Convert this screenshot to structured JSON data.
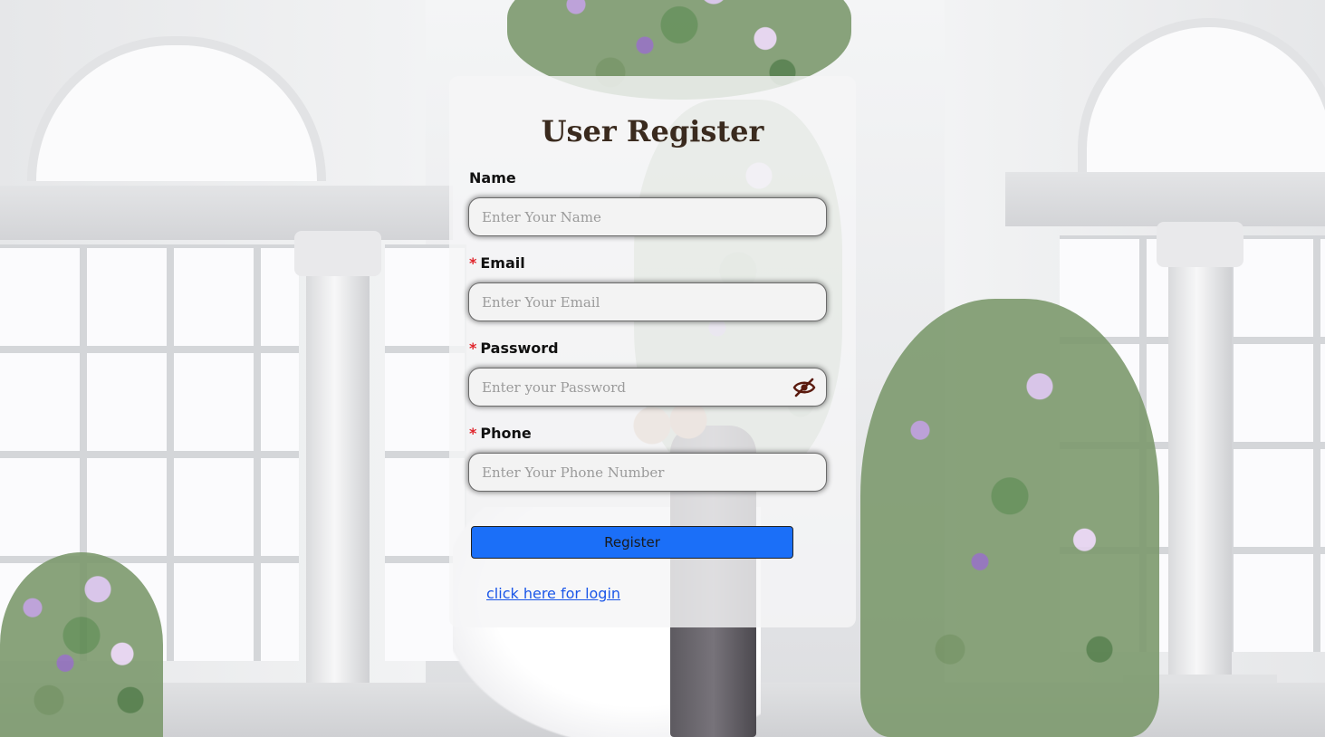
{
  "form": {
    "title": "User Register",
    "fields": {
      "name": {
        "label": "Name",
        "placeholder": "Enter Your Name",
        "required": false
      },
      "email": {
        "label": "Email",
        "placeholder": "Enter Your Email",
        "required": true
      },
      "password": {
        "label": "Password",
        "placeholder": "Enter your Password",
        "required": true
      },
      "phone": {
        "label": "Phone",
        "placeholder": "Enter Your Phone Number",
        "required": true
      }
    },
    "required_marker": "*",
    "password_toggle_icon": "eye-off-icon",
    "submit_label": "Register",
    "login_link_text": "click here for login"
  },
  "colors": {
    "primary_button": "#1b6ff8",
    "required_marker": "#e0242b",
    "link": "#1a56e8",
    "title": "#3a2a1e"
  }
}
